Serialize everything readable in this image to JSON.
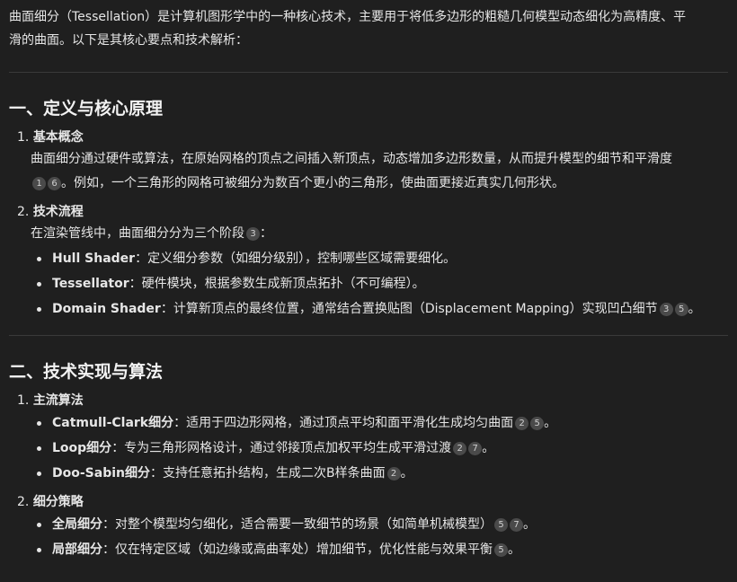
{
  "intro": {
    "line1": "曲面细分（Tessellation）是计算机图形学中的一种核心技术，主要用于将低多边形的粗糙几何模型动态细化为高精度、平",
    "line2": "滑的曲面。以下是其核心要点和技术解析："
  },
  "section1": {
    "title": "一、定义与核心原理",
    "item1": {
      "num": "1.",
      "label": "基本概念",
      "text_a": "曲面细分通过硬件或算法，在原始网格的顶点之间插入新顶点，动态增加多边形数量，从而提升模型的细节和平滑度",
      "cites": [
        "1",
        "6"
      ],
      "text_b": "。例如，一个三角形的网格可被细分为数百个更小的三角形，使曲面更接近真实几何形状。"
    },
    "item2": {
      "num": "2.",
      "label": "技术流程",
      "intro_a": "在渲染管线中，曲面细分分为三个阶段",
      "intro_cites": [
        "3"
      ],
      "intro_b": "：",
      "bullets": [
        {
          "term": "Hull Shader",
          "desc": "：定义细分参数（如细分级别），控制哪些区域需要细化。",
          "cites": []
        },
        {
          "term": "Tessellator",
          "desc": "：硬件模块，根据参数生成新顶点拓扑（不可编程）。",
          "cites": []
        },
        {
          "term": "Domain Shader",
          "desc": "：计算新顶点的最终位置，通常结合置换贴图（Displacement Mapping）实现凹凸细节",
          "cites": [
            "3",
            "5"
          ],
          "tail": "。"
        }
      ]
    }
  },
  "section2": {
    "title": "二、技术实现与算法",
    "item1": {
      "num": "1.",
      "label": "主流算法",
      "bullets": [
        {
          "term": "Catmull-Clark细分",
          "desc": "：适用于四边形网格，通过顶点平均和面平滑化生成均匀曲面",
          "cites": [
            "2",
            "5"
          ],
          "tail": "。"
        },
        {
          "term": "Loop细分",
          "desc": "：专为三角形网格设计，通过邻接顶点加权平均生成平滑过渡",
          "cites": [
            "2",
            "7"
          ],
          "tail": "。"
        },
        {
          "term": "Doo-Sabin细分",
          "desc": "：支持任意拓扑结构，生成二次B样条曲面",
          "cites": [
            "2"
          ],
          "tail": "。"
        }
      ]
    },
    "item2": {
      "num": "2.",
      "label": "细分策略",
      "bullets": [
        {
          "term": "全局细分",
          "desc": "：对整个模型均匀细化，适合需要一致细节的场景（如简单机械模型）",
          "cites": [
            "5",
            "7"
          ],
          "tail": "。"
        },
        {
          "term": "局部细分",
          "desc": "：仅在特定区域（如边缘或高曲率处）增加细节，优化性能与效果平衡",
          "cites": [
            "5"
          ],
          "tail": "。"
        }
      ]
    }
  }
}
